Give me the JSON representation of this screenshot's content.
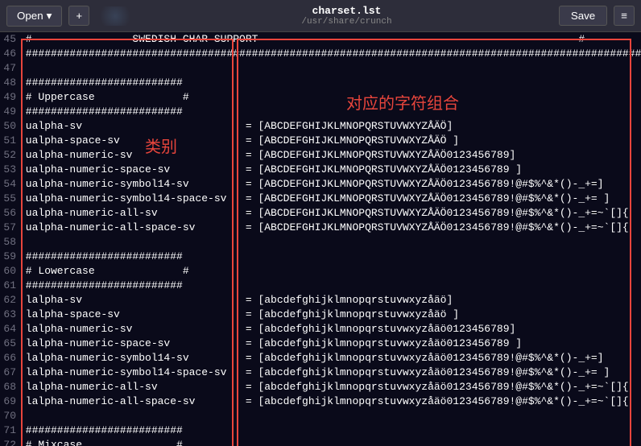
{
  "header": {
    "open_label": "Open",
    "new_icon": "+",
    "title": "charset.lst",
    "subtitle": "/usr/share/crunch",
    "save_label": "Save"
  },
  "annotations": {
    "label1": "类别",
    "label2": "对应的字符组合"
  },
  "lines": [
    {
      "n": "45",
      "def": "#",
      "mid": "SWEDISH CHAR-SUPPORT",
      "eq": "",
      "val": "#"
    },
    {
      "n": "46",
      "def": "#########################################################################################################",
      "eq": "",
      "val": ""
    },
    {
      "n": "47",
      "def": "",
      "eq": "",
      "val": ""
    },
    {
      "n": "48",
      "def": "#########################",
      "eq": "",
      "val": ""
    },
    {
      "n": "49",
      "def": "# Uppercase              #",
      "eq": "",
      "val": ""
    },
    {
      "n": "49",
      "def": "#########################",
      "eq": "",
      "val": ""
    },
    {
      "n": "50",
      "def": "ualpha-sv",
      "eq": "=",
      "val": "[ABCDEFGHIJKLMNOPQRSTUVWXYZÅÄÖ]"
    },
    {
      "n": "51",
      "def": "ualpha-space-sv",
      "eq": "=",
      "val": "[ABCDEFGHIJKLMNOPQRSTUVWXYZÅÄÖ ]"
    },
    {
      "n": "52",
      "def": "ualpha-numeric-sv",
      "eq": "=",
      "val": "[ABCDEFGHIJKLMNOPQRSTUVWXYZÅÄÖ0123456789]"
    },
    {
      "n": "53",
      "def": "ualpha-numeric-space-sv",
      "eq": "=",
      "val": "[ABCDEFGHIJKLMNOPQRSTUVWXYZÅÄÖ0123456789 ]"
    },
    {
      "n": "54",
      "def": "ualpha-numeric-symbol14-sv",
      "eq": "=",
      "val": "[ABCDEFGHIJKLMNOPQRSTUVWXYZÅÄÖ0123456789!@#$%^&*()-_+=]"
    },
    {
      "n": "55",
      "def": "ualpha-numeric-symbol14-space-sv",
      "eq": "=",
      "val": "[ABCDEFGHIJKLMNOPQRSTUVWXYZÅÄÖ0123456789!@#$%^&*()-_+= ]"
    },
    {
      "n": "56",
      "def": "ualpha-numeric-all-sv",
      "eq": "=",
      "val": "[ABCDEFGHIJKLMNOPQRSTUVWXYZÅÄÖ0123456789!@#$%^&*()-_+=~`[]{"
    },
    {
      "n": "57",
      "def": "ualpha-numeric-all-space-sv",
      "eq": "=",
      "val": "[ABCDEFGHIJKLMNOPQRSTUVWXYZÅÄÖ0123456789!@#$%^&*()-_+=~`[]{"
    },
    {
      "n": "58",
      "def": "",
      "eq": "",
      "val": ""
    },
    {
      "n": "59",
      "def": "#########################",
      "eq": "",
      "val": ""
    },
    {
      "n": "60",
      "def": "# Lowercase              #",
      "eq": "",
      "val": ""
    },
    {
      "n": "61",
      "def": "#########################",
      "eq": "",
      "val": ""
    },
    {
      "n": "62",
      "def": "lalpha-sv",
      "eq": "=",
      "val": "[abcdefghijklmnopqrstuvwxyzåäö]"
    },
    {
      "n": "63",
      "def": "lalpha-space-sv",
      "eq": "=",
      "val": "[abcdefghijklmnopqrstuvwxyzåäö ]"
    },
    {
      "n": "64",
      "def": "lalpha-numeric-sv",
      "eq": "=",
      "val": "[abcdefghijklmnopqrstuvwxyzåäö0123456789]"
    },
    {
      "n": "65",
      "def": "lalpha-numeric-space-sv",
      "eq": "=",
      "val": "[abcdefghijklmnopqrstuvwxyzåäö0123456789 ]"
    },
    {
      "n": "66",
      "def": "lalpha-numeric-symbol14-sv",
      "eq": "=",
      "val": "[abcdefghijklmnopqrstuvwxyzåäö0123456789!@#$%^&*()-_+=]"
    },
    {
      "n": "67",
      "def": "lalpha-numeric-symbol14-space-sv",
      "eq": "=",
      "val": "[abcdefghijklmnopqrstuvwxyzåäö0123456789!@#$%^&*()-_+= ]"
    },
    {
      "n": "68",
      "def": "lalpha-numeric-all-sv",
      "eq": "=",
      "val": "[abcdefghijklmnopqrstuvwxyzåäö0123456789!@#$%^&*()-_+=~`[]{"
    },
    {
      "n": "69",
      "def": "lalpha-numeric-all-space-sv",
      "eq": "=",
      "val": "[abcdefghijklmnopqrstuvwxyzåäö0123456789!@#$%^&*()-_+=~`[]{"
    },
    {
      "n": "70",
      "def": "",
      "eq": "",
      "val": ""
    },
    {
      "n": "71",
      "def": "#########################",
      "eq": "",
      "val": ""
    },
    {
      "n": "72",
      "def": "# Mixcase               #",
      "eq": "",
      "val": ""
    }
  ]
}
